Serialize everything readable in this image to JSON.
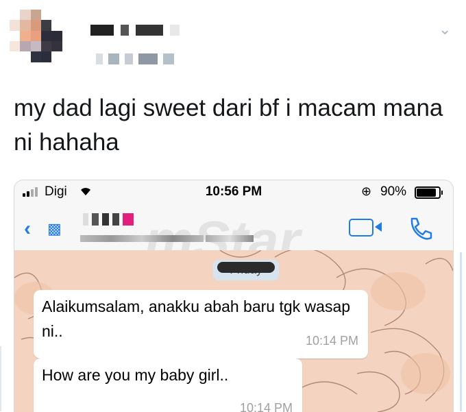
{
  "tweet": {
    "text": "my dad lagi sweet dari bf i macam mana ni hahaha",
    "menu_icon": "chevron-down-icon"
  },
  "screenshot": {
    "status_bar": {
      "carrier": "Digi",
      "time": "10:56 PM",
      "battery": "90%",
      "icons": [
        "signal-icon",
        "wifi-icon",
        "orientation-lock-icon",
        "battery-icon"
      ]
    },
    "nav": {
      "icons": [
        "back-chevron-icon",
        "video-call-icon",
        "phone-icon"
      ]
    },
    "watermark": "mStar",
    "chat": {
      "day_label": "Friday",
      "messages": [
        {
          "text": "Alaikumsalam, anakku abah baru tgk wasap ni..",
          "time": "10:14 PM"
        },
        {
          "text": "How are you my baby girl..",
          "time": "10:14 PM"
        }
      ]
    }
  },
  "colors": {
    "accent": "#1f7be8",
    "chat_bg": "#f4d4c0",
    "bubble": "#ffffff",
    "text": "#14171a"
  }
}
